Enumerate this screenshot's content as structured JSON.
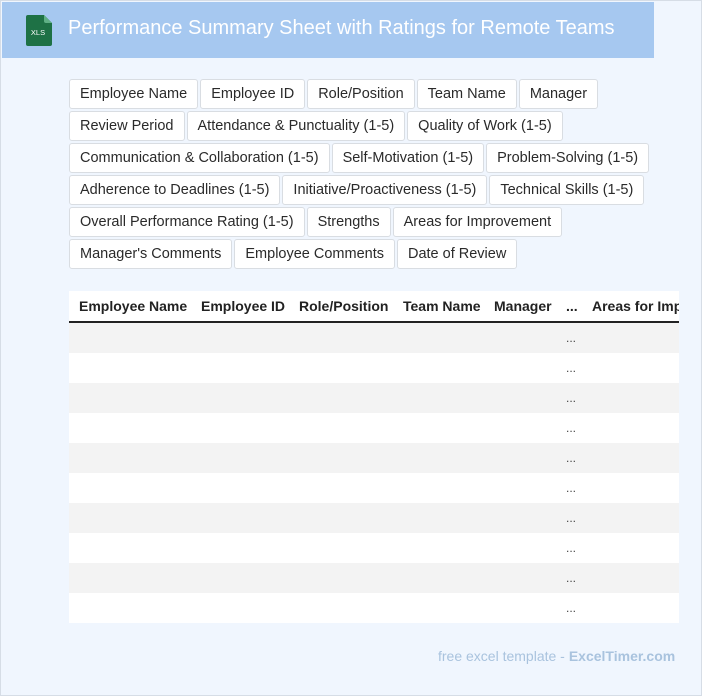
{
  "header": {
    "icon": "xls-file-icon",
    "icon_label": "XLS",
    "title": "Performance Summary Sheet with Ratings for Remote Teams",
    "colors": {
      "bar": "#a6c8f0",
      "icon": "#1e7145"
    }
  },
  "fields": [
    [
      "Employee Name",
      "Employee ID",
      "Role/Position",
      "Team Name",
      "Manager"
    ],
    [
      "Review Period",
      "Attendance & Punctuality (1-5)",
      "Quality of Work (1-5)"
    ],
    [
      "Communication & Collaboration (1-5)",
      "Self-Motivation (1-5)",
      "Problem-Solving (1-5)"
    ],
    [
      "Adherence to Deadlines (1-5)",
      "Initiative/Proactiveness (1-5)",
      "Technical Skills (1-5)"
    ],
    [
      "Overall Performance Rating (1-5)",
      "Strengths",
      "Areas for Improvement"
    ],
    [
      "Manager's Comments",
      "Employee Comments",
      "Date of Review"
    ]
  ],
  "table": {
    "columns": [
      "Employee Name",
      "Employee ID",
      "Role/Position",
      "Team Name",
      "Manager",
      "...",
      "Areas for Improvement"
    ],
    "ellipsis_cell": "...",
    "row_count": 10
  },
  "footer": {
    "text": "free excel template -",
    "brand": "ExcelTimer.com"
  }
}
